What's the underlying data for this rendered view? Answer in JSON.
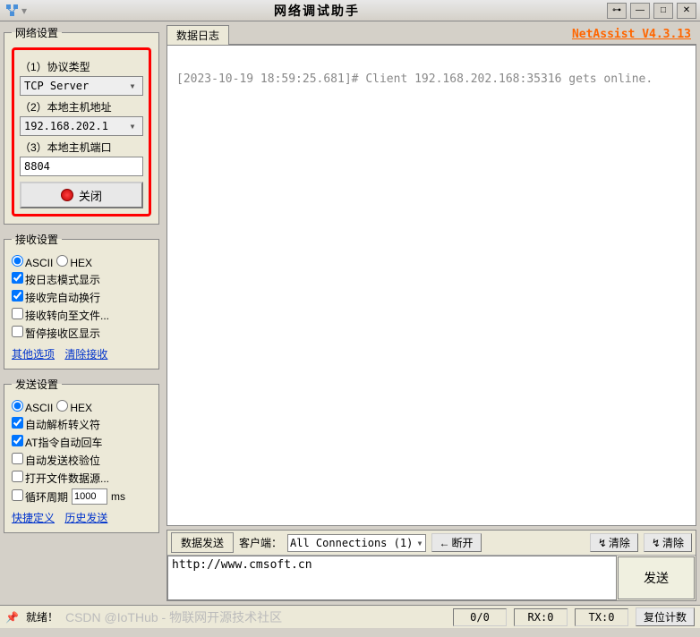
{
  "window": {
    "title": "网络调试助手",
    "brand": "NetAssist V4.3.13"
  },
  "network": {
    "legend": "网络设置",
    "protocol_label": "（1）协议类型",
    "protocol_value": "TCP Server",
    "host_label": "（2）本地主机地址",
    "host_value": "192.168.202.1",
    "port_label": "（3）本地主机端口",
    "port_value": "8804",
    "close_btn": "关闭"
  },
  "recv": {
    "legend": "接收设置",
    "ascii": "ASCII",
    "hex": "HEX",
    "opt_logmode": "按日志模式显示",
    "opt_autonl": "接收完自动换行",
    "opt_tofile": "接收转向至文件...",
    "opt_pause": "暂停接收区显示",
    "link_other": "其他选项",
    "link_clear": "清除接收"
  },
  "send": {
    "legend": "发送设置",
    "ascii": "ASCII",
    "hex": "HEX",
    "opt_escape": "自动解析转义符",
    "opt_at": "AT指令自动回车",
    "opt_crc": "自动发送校验位",
    "opt_filesrc": "打开文件数据源...",
    "opt_cycle": "循环周期",
    "cycle_value": "1000",
    "cycle_unit": "ms",
    "link_quick": "快捷定义",
    "link_history": "历史发送"
  },
  "log": {
    "tab": "数据日志",
    "content": "[2023-10-19 18:59:25.681]# Client 192.168.202.168:35316 gets online."
  },
  "sendbar": {
    "tab": "数据发送",
    "client_lbl": "客户端：",
    "conn_value": "All Connections (1)",
    "disconnect": "断开",
    "clear_recv": "清除",
    "clear_send": "清除",
    "send_btn": "发送",
    "input_value": "http://www.cmsoft.cn"
  },
  "status": {
    "ready": "就绪！",
    "counter": "0/0",
    "rx": "RX:0",
    "tx": "TX:0",
    "reset": "复位计数",
    "watermark": "CSDN @IoTHub - 物联网开源技术社区"
  }
}
